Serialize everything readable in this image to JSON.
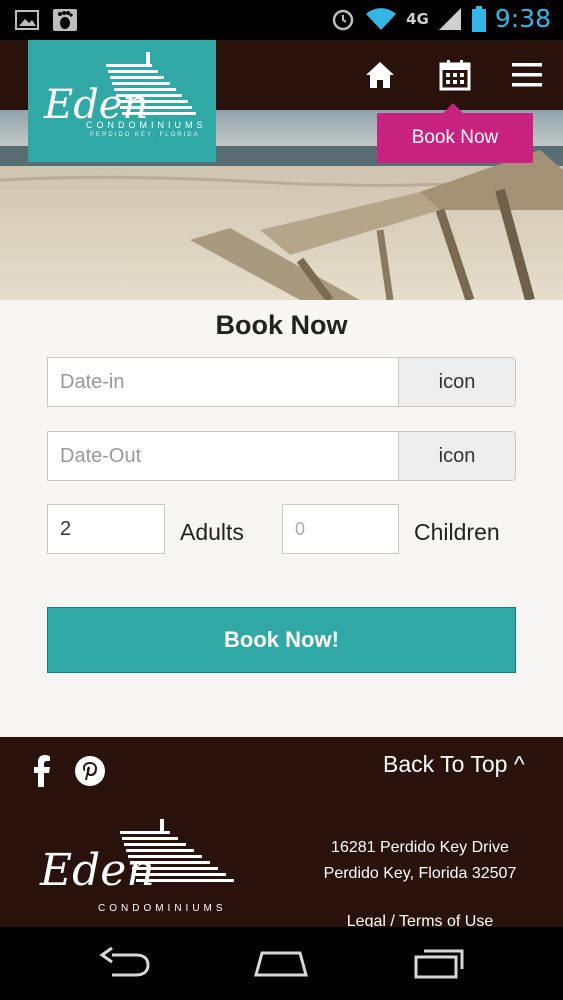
{
  "status_bar": {
    "time": "9:38",
    "network": "4G",
    "icons": [
      "image-notification-icon",
      "footprint-notification-icon",
      "alarm-icon",
      "wifi-icon",
      "signal-icon",
      "battery-icon"
    ]
  },
  "header": {
    "logo_text": "Eden",
    "logo_sub": "CONDOMINIUMS",
    "logo_tagline": "PERDIDO KEY, FLORIDA",
    "nav": [
      "home-icon",
      "calendar-icon",
      "menu-icon"
    ],
    "tooltip_label": "Book Now"
  },
  "booking_form": {
    "title": "Book Now",
    "date_in": {
      "placeholder": "Date-in",
      "value": "",
      "addon": "icon"
    },
    "date_out": {
      "placeholder": "Date-Out",
      "value": "",
      "addon": "icon"
    },
    "adults": {
      "value": "2",
      "label": "Adults"
    },
    "children": {
      "placeholder": "0",
      "label": "Children"
    },
    "submit_label": "Book Now!"
  },
  "footer": {
    "social": [
      "facebook-icon",
      "pinterest-icon"
    ],
    "back_to_top": "Back To Top ^",
    "address_line1": "16281 Perdido Key Drive",
    "address_line2": "Perdido Key, Florida 32507",
    "legal": "Legal / Terms of Use"
  },
  "colors": {
    "brand_teal": "#2fa8a6",
    "brand_magenta": "#c7237e",
    "dark_brown": "#2a120c",
    "status_blue": "#33b5e5"
  }
}
